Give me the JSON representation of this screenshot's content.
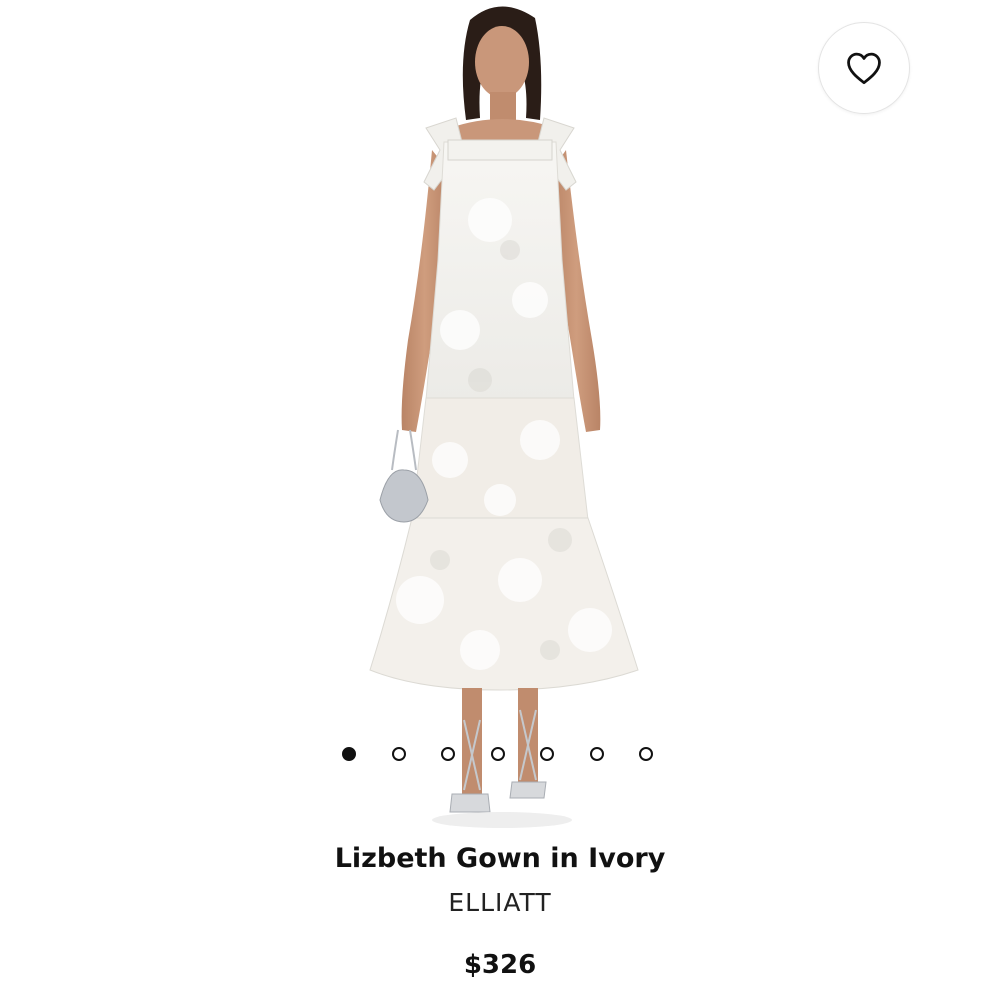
{
  "product": {
    "title": "Lizbeth Gown in Ivory",
    "brand": "ELLIATT",
    "price": "$326"
  },
  "gallery": {
    "total_images": 7,
    "active_index": 0
  },
  "wishlist": {
    "icon": "heart-outline-icon"
  },
  "colors": {
    "text": "#111111",
    "background": "#ffffff",
    "dress": "#f4f2ee",
    "lining": "#efe3d9",
    "skin": "#c69474",
    "hair": "#2a1d17"
  }
}
